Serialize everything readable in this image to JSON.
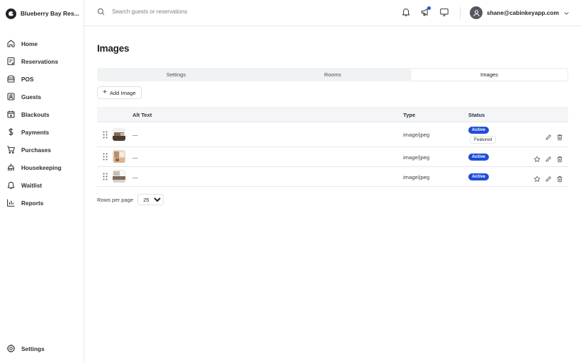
{
  "brand": {
    "name": "Blueberry Bay Res..."
  },
  "sidebar": {
    "items": [
      {
        "label": "Home",
        "icon": "home-icon"
      },
      {
        "label": "Reservations",
        "icon": "reservations-icon"
      },
      {
        "label": "POS",
        "icon": "pos-icon"
      },
      {
        "label": "Guests",
        "icon": "guests-icon"
      },
      {
        "label": "Blackouts",
        "icon": "calendar-icon"
      },
      {
        "label": "Payments",
        "icon": "dollar-icon"
      },
      {
        "label": "Purchases",
        "icon": "cart-icon"
      },
      {
        "label": "Housekeeping",
        "icon": "housekeeping-icon"
      },
      {
        "label": "Waitlist",
        "icon": "bell-icon"
      },
      {
        "label": "Reports",
        "icon": "chart-icon"
      }
    ],
    "settings": {
      "label": "Settings",
      "icon": "gear-icon"
    }
  },
  "topbar": {
    "search_placeholder": "Search guests or reservations",
    "user_email": "shane@cabinkeyapp.com"
  },
  "page": {
    "title": "Images"
  },
  "tabs": [
    {
      "label": "Settings",
      "active": false
    },
    {
      "label": "Rooms",
      "active": false
    },
    {
      "label": "Images",
      "active": true
    }
  ],
  "toolbar": {
    "add_label": "Add Image"
  },
  "table": {
    "headers": {
      "alt": "Alt Text",
      "type": "Type",
      "status": "Status"
    },
    "rows": [
      {
        "alt": "—",
        "type": "image/jpeg",
        "status": "Active",
        "featured": "Featured"
      },
      {
        "alt": "—",
        "type": "image/jpeg",
        "status": "Active"
      },
      {
        "alt": "—",
        "type": "image/jpeg",
        "status": "Active"
      }
    ]
  },
  "pagination": {
    "rows_label": "Rows per page",
    "rows_value": "25",
    "options": [
      "25"
    ]
  },
  "colors": {
    "accent": "#1d4ed8",
    "notification_dot": "#1e5ddb",
    "border": "#e6e8eb"
  }
}
